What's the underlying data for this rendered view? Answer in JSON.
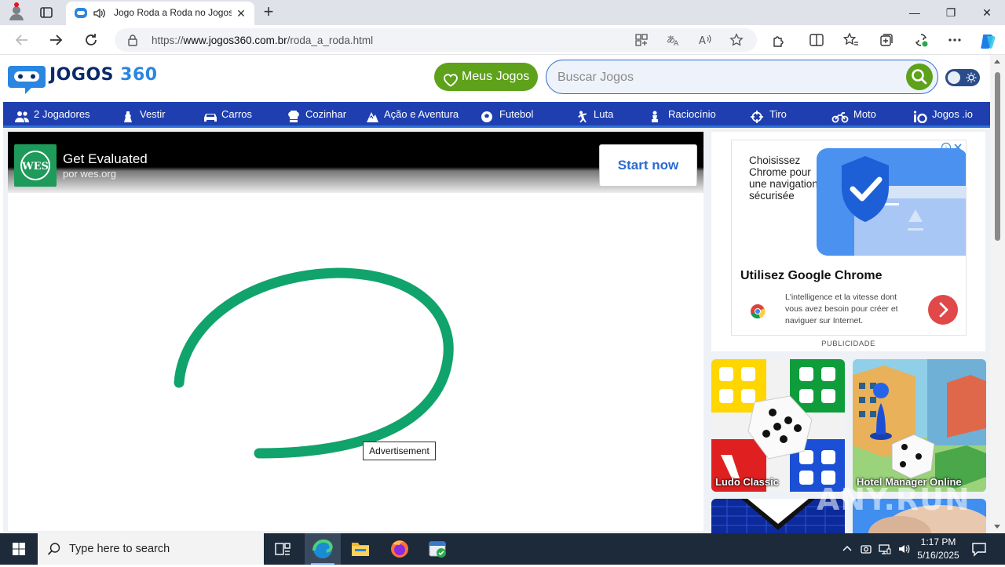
{
  "browser": {
    "tab_title": "Jogo Roda a Roda no Jogos",
    "url_prefix": "https://",
    "url_domain": "www.jogos360.com.br",
    "url_path": "/roda_a_roda.html",
    "window_controls": [
      "minimize",
      "restore",
      "close"
    ]
  },
  "site": {
    "logo_text": "JOGOS",
    "logo_number": "360",
    "meus_jogos_label": "Meus Jogos",
    "search_placeholder": "Buscar Jogos",
    "brand_colors": {
      "blue": "#1f3fb0",
      "green": "#5ea11a"
    }
  },
  "categories": [
    {
      "label": "2 Jogadores",
      "icon": "two-players-icon"
    },
    {
      "label": "Vestir",
      "icon": "dress-icon"
    },
    {
      "label": "Carros",
      "icon": "car-icon"
    },
    {
      "label": "Cozinhar",
      "icon": "chef-hat-icon"
    },
    {
      "label": "Ação e Aventura",
      "icon": "adventure-icon"
    },
    {
      "label": "Futebol",
      "icon": "soccer-ball-icon"
    },
    {
      "label": "Luta",
      "icon": "fighter-icon"
    },
    {
      "label": "Raciocínio",
      "icon": "chess-icon"
    },
    {
      "label": "Tiro",
      "icon": "crosshair-icon"
    },
    {
      "label": "Moto",
      "icon": "motorcycle-icon"
    },
    {
      "label": "Jogos .io",
      "icon": "io-icon"
    }
  ],
  "top_ad": {
    "title": "Get Evaluated",
    "subtitle": "por wes.org",
    "cta": "Start now",
    "logo_text": "WES"
  },
  "advertisement_label": "Advertisement",
  "side_ad": {
    "french_text": "Choisissez Chrome pour une navigation sécurisée",
    "headline": "Utilisez Google Chrome",
    "body": "L'intelligence et la vitesse dont vous avez besoin pour créer et naviguer sur Internet.",
    "publicidade_label": "PUBLICIDADE"
  },
  "game_tiles": [
    {
      "title": "Ludo Classic"
    },
    {
      "title": "Hotel Manager Online"
    }
  ],
  "watermark": "ANY.RUN",
  "taskbar": {
    "search_placeholder": "Type here to search",
    "time": "1:17 PM",
    "date": "5/16/2025"
  }
}
